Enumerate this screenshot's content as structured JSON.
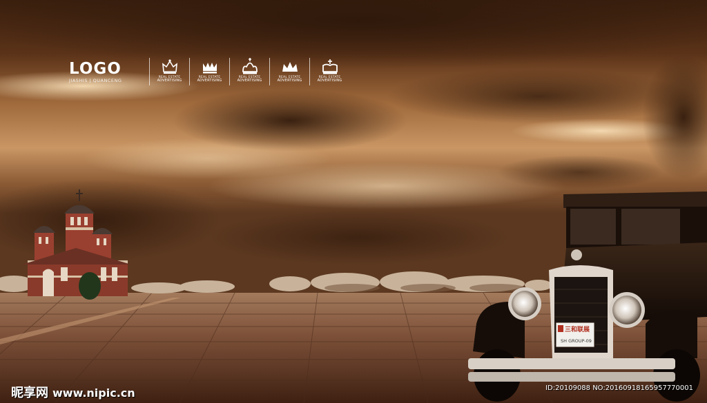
{
  "brand": {
    "logo": "LOGO",
    "logo_sub": "JIASHIS | QUANCENG"
  },
  "badges": [
    {
      "icon": "crown-icon-1",
      "line1": "REAL ESTATE",
      "line2": "ADVERTISING"
    },
    {
      "icon": "crown-icon-2",
      "line1": "REAL ESTATE",
      "line2": "ADVERTISING"
    },
    {
      "icon": "crown-icon-3",
      "line1": "REAL ESTATE",
      "line2": "ADVERTISING"
    },
    {
      "icon": "crown-icon-4",
      "line1": "REAL ESTATE",
      "line2": "ADVERTISING"
    },
    {
      "icon": "crown-icon-5",
      "line1": "REAL ESTATE",
      "line2": "ADVERTISING"
    }
  ],
  "plate": {
    "top": "三和联展",
    "bottom": "SH GROUP-09"
  },
  "watermark": {
    "brand": "昵享网",
    "url": "www.nipic.cn",
    "id": "ID:20109088 NO:20160918165957770001"
  },
  "colors": {
    "sky_dark": "#3a1f0e",
    "sky_light": "#e8c49a",
    "ground": "#8a5e42",
    "accent": "#ffffff"
  }
}
